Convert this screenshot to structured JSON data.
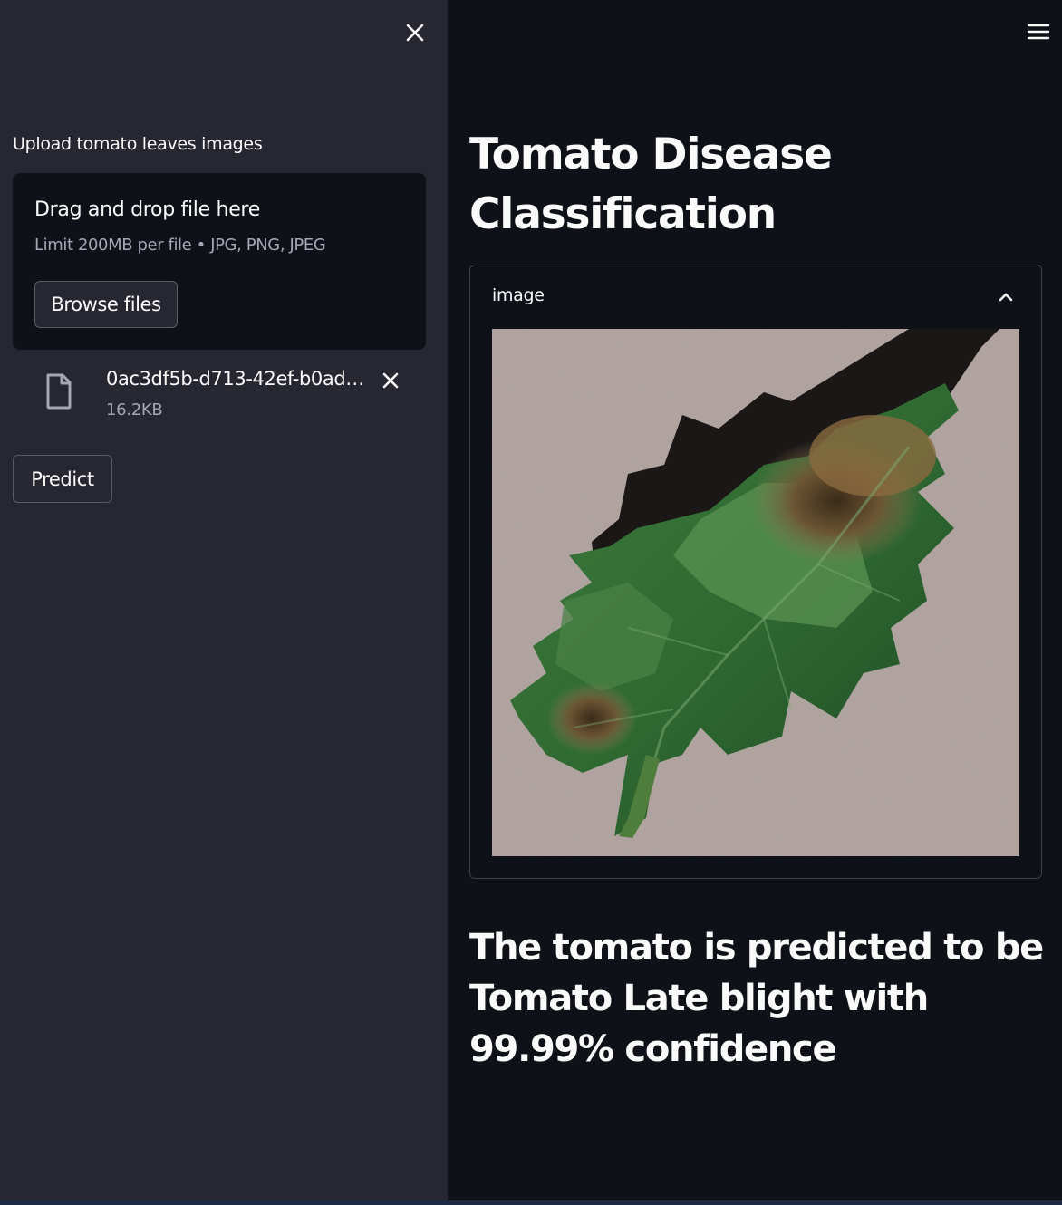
{
  "sidebar": {
    "uploader_label": "Upload tomato leaves images",
    "dropzone": {
      "title": "Drag and drop file here",
      "limit": "Limit 200MB per file • JPG, PNG, JPEG",
      "browse_label": "Browse files"
    },
    "file": {
      "name": "0ac3df5b-d713-42ef-b0ad-…",
      "size": "16.2KB"
    },
    "predict_label": "Predict"
  },
  "main": {
    "title": "Tomato Disease Classification",
    "expander_label": "image",
    "result": "The tomato is predicted to be Tomato Late blight with 99.99% confidence"
  },
  "icons": {
    "sidebar_close": "close-icon",
    "menu": "hamburger-menu-icon",
    "file": "file-icon",
    "file_remove": "close-icon",
    "expander": "chevron-up-icon"
  },
  "colors": {
    "main_bg": "#0e1117",
    "sidebar_bg": "#262730",
    "text": "#fafafa",
    "muted_text": "#a3a8b4"
  }
}
